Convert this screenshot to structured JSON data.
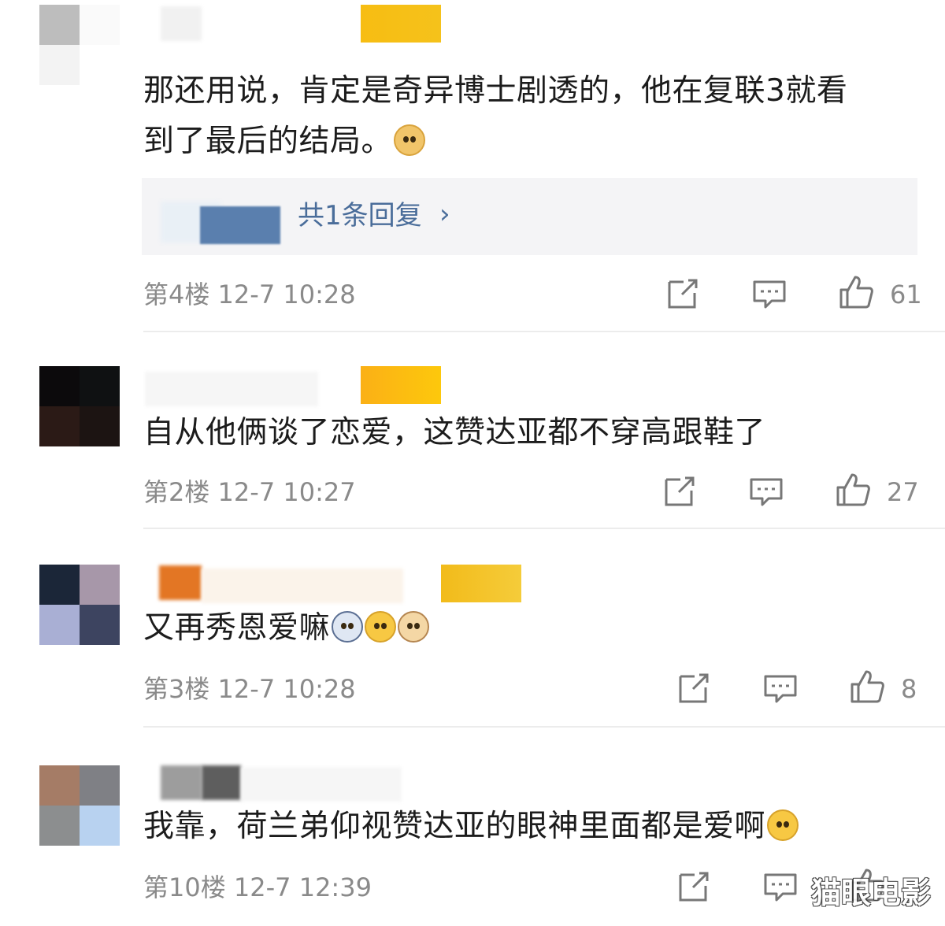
{
  "comments": [
    {
      "text_line1": "那还用说，肯定是奇异博士剧透的，他在复联3就看",
      "text_line2": "到了最后的结局。",
      "reply_link": "共1条回复",
      "reply_arrow": "›",
      "floor": "第4楼",
      "time": "12-7 10:28",
      "likes": "61"
    },
    {
      "text": "自从他俩谈了恋爱，这赞达亚都不穿高跟鞋了",
      "floor": "第2楼",
      "time": "12-7 10:27",
      "likes": "27"
    },
    {
      "text": "又再秀恩爱嘛",
      "floor": "第3楼",
      "time": "12-7 10:28",
      "likes": "8"
    },
    {
      "text": "我靠，荷兰弟仰视赞达亚的眼神里面都是爱啊",
      "floor": "第10楼",
      "time": "12-7 12:39"
    }
  ],
  "watermark": "猫眼电影",
  "colors": {
    "reply_link": "#4a6d9a",
    "meta_text": "#8a8a8a",
    "badge_gold": "#f5c21b",
    "divider": "#ececec"
  }
}
